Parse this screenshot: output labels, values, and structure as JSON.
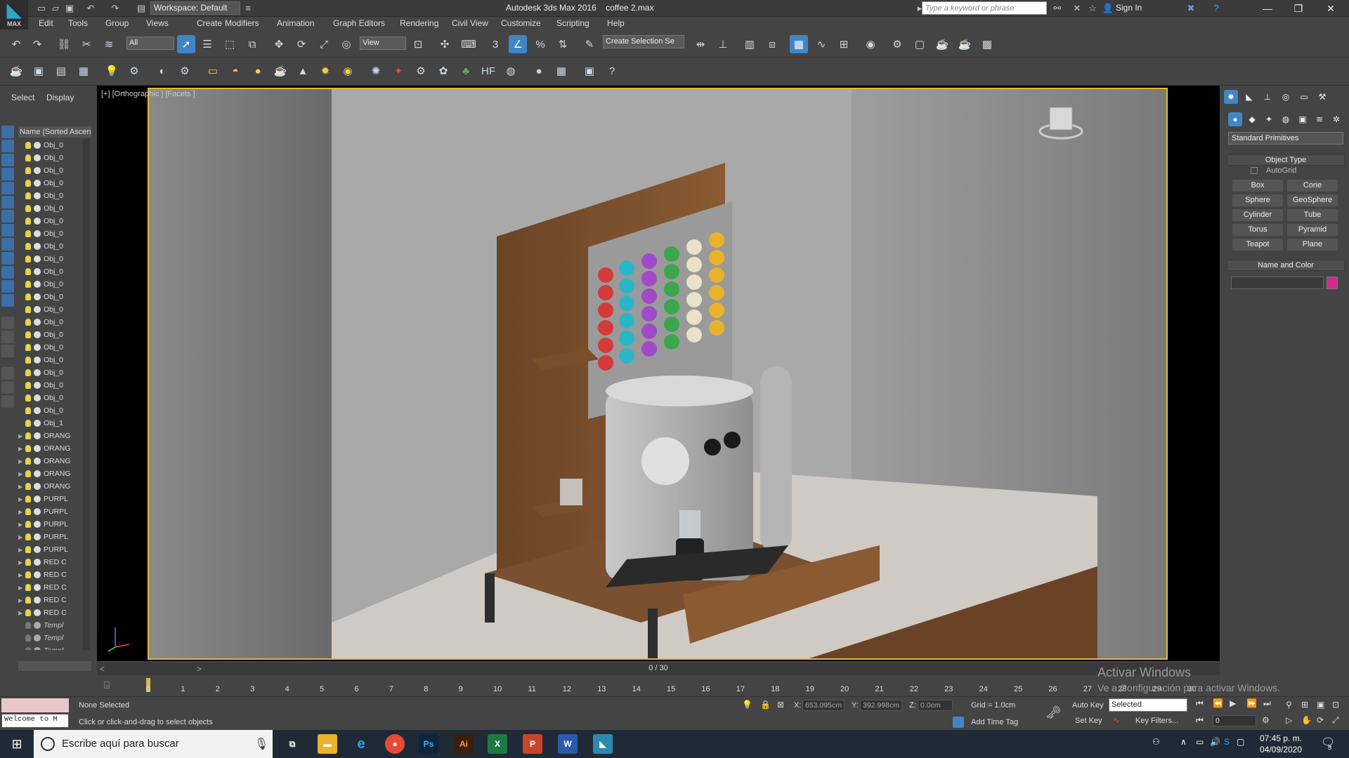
{
  "app": {
    "title": "Autodesk 3ds Max 2016",
    "file": "coffee 2.max",
    "logo_text": "MAX",
    "workspace": "Workspace: Default",
    "search_placeholder": "Type a keyword or phrase",
    "sign_in": "Sign In"
  },
  "menu": [
    "Edit",
    "Tools",
    "Group",
    "Views",
    "Create",
    "Modifiers",
    "Animation",
    "Graph Editors",
    "Rendering",
    "Civil View",
    "Customize",
    "Scripting",
    "Help"
  ],
  "toolbar": {
    "selection_filter": "All",
    "coord_system": "View",
    "named_selection_placeholder": "Create Selection Se"
  },
  "left_panel": {
    "tabs": [
      "Select",
      "Display"
    ],
    "list_header": "Name (Sorted Ascen",
    "objects": [
      "Obj_0",
      "Obj_0",
      "Obj_0",
      "Obj_0",
      "Obj_0",
      "Obj_0",
      "Obj_0",
      "Obj_0",
      "Obj_0",
      "Obj_0",
      "Obj_0",
      "Obj_0",
      "Obj_0",
      "Obj_0",
      "Obj_0",
      "Obj_0",
      "Obj_0",
      "Obj_0",
      "Obj_0",
      "Obj_0",
      "Obj_0",
      "Obj_0",
      "Obj_1"
    ],
    "groups": [
      "ORANG",
      "ORANG",
      "ORANG",
      "ORANG",
      "ORANG",
      "PURPL",
      "PURPL",
      "PURPL",
      "PURPL",
      "PURPL",
      "RED C",
      "RED C",
      "RED C",
      "RED C",
      "RED C"
    ],
    "templates": [
      "Templ",
      "Templ",
      "Templ"
    ]
  },
  "viewport": {
    "label": "[+] [Orthographic ] [Facets ]"
  },
  "command_panel": {
    "category": "Standard Primitives",
    "object_type_title": "Object Type",
    "autogrid": "AutoGrid",
    "buttons": [
      "Box",
      "Cone",
      "Sphere",
      "GeoSphere",
      "Cylinder",
      "Tube",
      "Torus",
      "Pyramid",
      "Teapot",
      "Plane"
    ],
    "name_color_title": "Name and Color",
    "object_color": "#d42a8f"
  },
  "timeline": {
    "slider": "0 / 30",
    "ticks": [
      "0",
      "1",
      "2",
      "3",
      "4",
      "5",
      "6",
      "7",
      "8",
      "9",
      "10",
      "11",
      "12",
      "13",
      "14",
      "15",
      "16",
      "17",
      "18",
      "19",
      "20",
      "21",
      "22",
      "23",
      "24",
      "25",
      "26",
      "27",
      "28",
      "29",
      "30"
    ]
  },
  "status": {
    "maxscript": "Welcome to M",
    "selection": "None Selected",
    "prompt": "Click or click-and-drag to select objects",
    "x_label": "X:",
    "x": "653.095cm",
    "y_label": "Y:",
    "y": "392.998cm",
    "z_label": "Z:",
    "z": "0.0cm",
    "grid": "Grid = 1.0cm",
    "add_time_tag": "Add Time Tag",
    "auto_key": "Auto Key",
    "key_mode": "Selected",
    "set_key": "Set Key",
    "key_filters": "Key Filters...",
    "frame": "0"
  },
  "windows": {
    "activate_title": "Activar Windows",
    "activate_sub": "Ve a Configuración para activar Windows.",
    "search": "Escribe aquí para buscar",
    "time": "07:45 p. m.",
    "date": "04/09/2020",
    "notif": "5"
  }
}
